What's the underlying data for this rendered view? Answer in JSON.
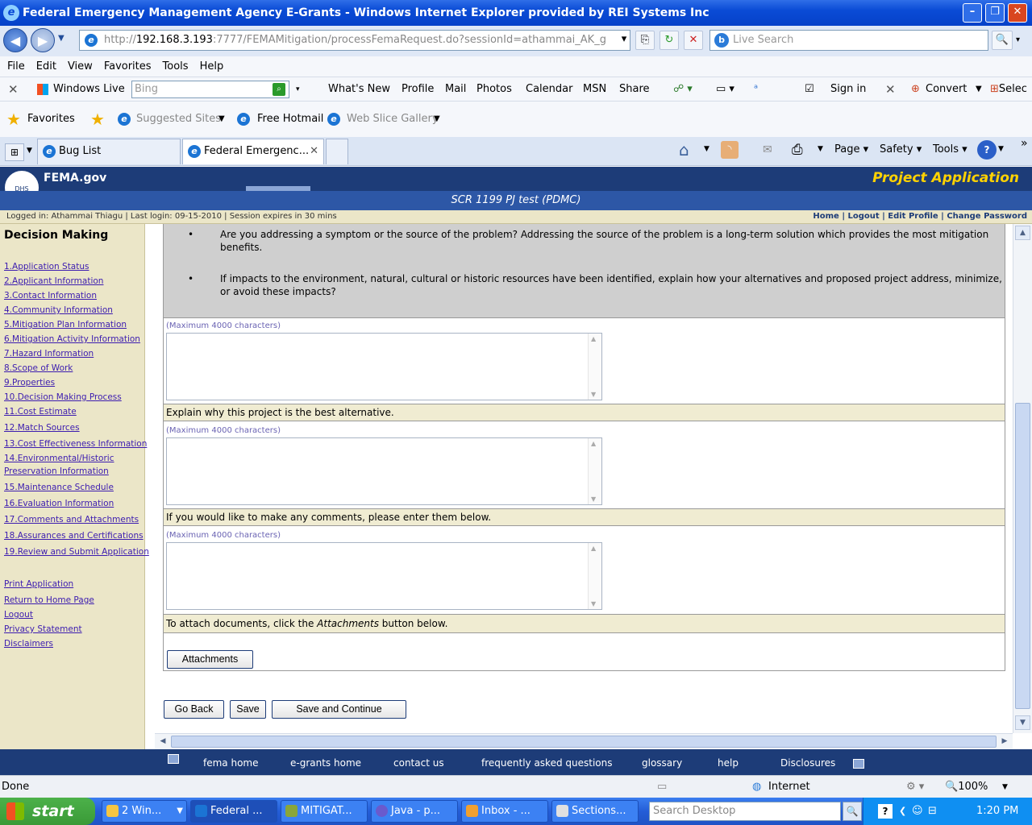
{
  "window": {
    "title": "Federal Emergency Management Agency E-Grants - Windows Internet Explorer provided by REI Systems Inc"
  },
  "addressbar": {
    "url_prefix": "http://",
    "url_host": "192.168.3.193",
    "url_rest": ":7777/FEMAMitigation/processFemaRequest.do?sessionId=athammai_AK_g",
    "search_placeholder": "Live Search"
  },
  "menu": [
    "File",
    "Edit",
    "View",
    "Favorites",
    "Tools",
    "Help"
  ],
  "toolbar": {
    "windows_live": "Windows Live",
    "bing_placeholder": "Bing",
    "links": [
      "What's New",
      "Profile",
      "Mail",
      "Photos",
      "Calendar",
      "MSN",
      "Share"
    ],
    "sign_in": "Sign in",
    "convert": "Convert",
    "select": "Selec"
  },
  "favorites_bar": {
    "favorites": "Favorites",
    "suggested_sites": "Suggested Sites",
    "free_hotmail": "Free Hotmail",
    "web_slice_gallery": "Web Slice Gallery"
  },
  "tabs": [
    {
      "label": "Bug List"
    },
    {
      "label": "Federal Emergenc..."
    }
  ],
  "command_bar": {
    "page": "Page",
    "safety": "Safety",
    "tools": "Tools"
  },
  "fema": {
    "site_name": "FEMA.gov",
    "section_title": "Project Application",
    "project_name": "SCR 1199 PJ test (PDMC)",
    "login_info": "Logged in: Athammai Thiagu   |  Last login: 09-15-2010   |  Session expires in 30 mins",
    "top_links": [
      "Home",
      "Logout",
      "Edit Profile",
      "Change Password"
    ]
  },
  "sidebar": {
    "heading": "Decision Making",
    "steps": [
      "1.Application Status",
      "2.Applicant Information",
      "3.Contact Information",
      "4.Community Information",
      "5.Mitigation Plan Information",
      "6.Mitigation Activity Information",
      "7.Hazard Information",
      "8.Scope of Work",
      "9.Properties",
      "10.Decision Making Process",
      "11.Cost Estimate",
      "12.Match Sources",
      "13.Cost Effectiveness Information",
      "14.Environmental/Historic",
      "Preservation Information",
      "15.Maintenance Schedule",
      "16.Evaluation Information",
      "17.Comments and Attachments",
      "18.Assurances and Certifications",
      "19.Review and Submit Application"
    ],
    "extra_links": [
      "Print Application",
      "Return to Home Page",
      "Logout",
      "Privacy Statement",
      "Disclaimers"
    ]
  },
  "main": {
    "bullets": [
      "Are you addressing a symptom or the source of the problem? Addressing the source of the problem is a long-term solution which provides the most mitigation benefits.",
      "If impacts to the environment, natural, cultural or historic resources have been identified, explain how your alternatives and proposed project address, minimize, or avoid these impacts?"
    ],
    "max_chars_label": "(Maximum 4000 characters)",
    "question_best_alternative": "Explain why this project is the best alternative.",
    "question_comments": "If you would like to make any comments, please enter them below.",
    "attach_prefix": "To attach documents, click the ",
    "attach_emph": "Attachments",
    "attach_suffix": " button below.",
    "attachments_button": "Attachments",
    "go_back_button": "Go Back",
    "save_button": "Save",
    "save_continue_button": "Save and Continue"
  },
  "footer_links": [
    "fema home",
    "e-grants home",
    "contact us",
    "frequently asked questions",
    "glossary",
    "help",
    "Disclosures"
  ],
  "statusbar": {
    "status": "Done",
    "zone": "Internet",
    "zoom": "100%"
  },
  "taskbar": {
    "start": "start",
    "items": [
      "2 Win...",
      "Federal ...",
      "MITIGAT...",
      "Java - p...",
      "Inbox - ...",
      "Sections..."
    ],
    "search_placeholder": "Search Desktop",
    "clock": "1:20 PM"
  }
}
